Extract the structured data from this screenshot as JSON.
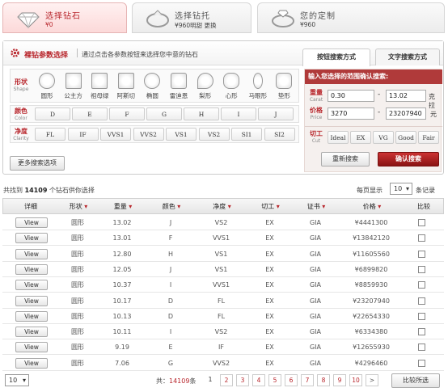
{
  "steps": [
    {
      "title": "选择钻石",
      "sub": "¥0"
    },
    {
      "title": "选择钻托",
      "sub": "¥960明甜 更换"
    },
    {
      "title": "您的定制",
      "sub": "¥960"
    }
  ],
  "panel": {
    "title": "裸钻参数选择",
    "desc": "通过点击各参数按钮来选择您中意的钻石",
    "tab_active": "按钮搜索方式",
    "tab_other": "文字搜索方式"
  },
  "shape": {
    "label": "形状",
    "en": "Shape",
    "items": [
      "圆形",
      "公主方",
      "祖母绿",
      "阿斯切",
      "椭圆",
      "雷迪恩",
      "梨形",
      "心形",
      "马眼形",
      "垫形"
    ]
  },
  "color": {
    "label": "颜色",
    "en": "Color",
    "items": [
      "D",
      "E",
      "F",
      "G",
      "H",
      "I",
      "J"
    ]
  },
  "clarity": {
    "label": "净度",
    "en": "Clarity",
    "items": [
      "FL",
      "IF",
      "VVS1",
      "VVS2",
      "VS1",
      "VS2",
      "SI1",
      "SI2"
    ]
  },
  "more_options": "更多搜索选项",
  "range": {
    "header": "输入您选择的范围确认搜索:",
    "weight_label": "重量",
    "weight_en": "Carat",
    "weight_min": "0.30",
    "weight_max": "13.02",
    "weight_unit": "克拉",
    "price_label": "价格",
    "price_en": "Price",
    "price_min": "3270",
    "price_max": "23207940",
    "price_unit": "元",
    "cut_label": "切工",
    "cut_en": "Cut",
    "cut_items": [
      "Ideal",
      "EX",
      "VG",
      "Good",
      "Fair"
    ],
    "reset": "重新搜索",
    "confirm": "确认搜索"
  },
  "summary": {
    "prefix": "共找到",
    "count": "14109",
    "suffix": "个钻石供你选择"
  },
  "per_page": {
    "label": "每页显示",
    "value": "10",
    "suffix": "条记录"
  },
  "headers": [
    "详细",
    "形状",
    "重量",
    "颜色",
    "净度",
    "切工",
    "证书",
    "价格",
    "比较"
  ],
  "view_label": "View",
  "rows": [
    {
      "shape": "圆形",
      "weight": "13.02",
      "color": "J",
      "clarity": "VS2",
      "cut": "EX",
      "cert": "GIA",
      "price": "¥4441300"
    },
    {
      "shape": "圆形",
      "weight": "13.01",
      "color": "F",
      "clarity": "VVS1",
      "cut": "EX",
      "cert": "GIA",
      "price": "¥13842120"
    },
    {
      "shape": "圆形",
      "weight": "12.80",
      "color": "H",
      "clarity": "VS1",
      "cut": "EX",
      "cert": "GIA",
      "price": "¥11605560"
    },
    {
      "shape": "圆形",
      "weight": "12.05",
      "color": "J",
      "clarity": "VS1",
      "cut": "EX",
      "cert": "GIA",
      "price": "¥6899820"
    },
    {
      "shape": "圆形",
      "weight": "10.37",
      "color": "I",
      "clarity": "VVS1",
      "cut": "EX",
      "cert": "GIA",
      "price": "¥8859930"
    },
    {
      "shape": "圆形",
      "weight": "10.17",
      "color": "D",
      "clarity": "FL",
      "cut": "EX",
      "cert": "GIA",
      "price": "¥23207940"
    },
    {
      "shape": "圆形",
      "weight": "10.13",
      "color": "D",
      "clarity": "FL",
      "cut": "EX",
      "cert": "GIA",
      "price": "¥22654330"
    },
    {
      "shape": "圆形",
      "weight": "10.11",
      "color": "I",
      "clarity": "VS2",
      "cut": "EX",
      "cert": "GIA",
      "price": "¥6334380"
    },
    {
      "shape": "圆形",
      "weight": "9.19",
      "color": "E",
      "clarity": "IF",
      "cut": "EX",
      "cert": "GIA",
      "price": "¥12655930"
    },
    {
      "shape": "圆形",
      "weight": "7.06",
      "color": "G",
      "clarity": "VVS2",
      "cut": "EX",
      "cert": "GIA",
      "price": "¥4296460"
    }
  ],
  "footer": {
    "per_page": "10",
    "total_prefix": "共：",
    "total": "14109",
    "total_suffix": "条",
    "pages": [
      "1",
      "2",
      "3",
      "4",
      "5",
      "6",
      "7",
      "8",
      "9",
      "10"
    ],
    "next": ">",
    "compare": "比较所选"
  },
  "colors": {
    "accent": "#b8262c",
    "confirm": "#8a1313"
  }
}
